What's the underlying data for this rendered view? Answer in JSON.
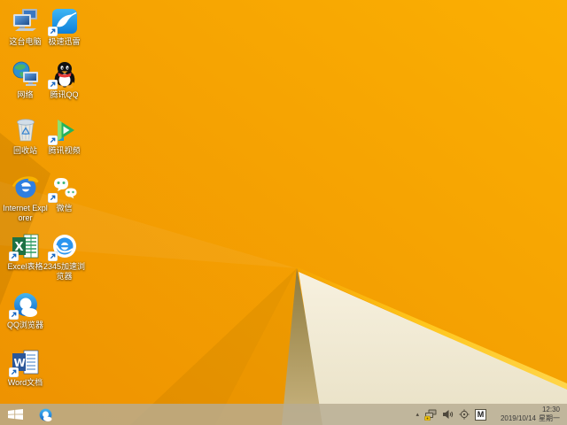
{
  "desktop": {
    "icons": [
      {
        "id": "this-pc",
        "label": "这台电脑",
        "shortcut": false
      },
      {
        "id": "xunlei",
        "label": "极速迅雷",
        "shortcut": true
      },
      {
        "id": "network",
        "label": "网络",
        "shortcut": false
      },
      {
        "id": "tencent-qq",
        "label": "腾讯QQ",
        "shortcut": true
      },
      {
        "id": "recycle-bin",
        "label": "回收站",
        "shortcut": false
      },
      {
        "id": "tencent-video",
        "label": "腾讯视频",
        "shortcut": true
      },
      {
        "id": "internet-explorer",
        "label": "Internet Explorer",
        "shortcut": false
      },
      {
        "id": "wechat",
        "label": "微信",
        "shortcut": true
      },
      {
        "id": "excel",
        "label": "Excel表格",
        "shortcut": true
      },
      {
        "id": "browser-2345",
        "label": "2345加速浏览器",
        "shortcut": true
      },
      {
        "id": "qq-browser",
        "label": "QQ浏览器",
        "shortcut": true
      },
      {
        "id": "word",
        "label": "Word文档",
        "shortcut": true
      }
    ]
  },
  "taskbar": {
    "start_button": {
      "icon": "windows-flag-icon"
    },
    "pinned": [
      {
        "id": "qq-browser",
        "name": "QQ浏览器"
      }
    ],
    "tray": {
      "hidden_icons_glyph": "▴",
      "icons": [
        "network-warning-icon",
        "volume-icon",
        "safety-target-icon",
        "input-method-indicator"
      ],
      "input_indicator": "M",
      "clock": {
        "time": "12:30",
        "date": "2019/10/14",
        "weekday": "星期一"
      }
    }
  },
  "colors": {
    "wallpaper-main-light": "#FBAF02",
    "wallpaper-main-deep": "#EE9201",
    "wallpaper-ridge": "#FFC61C",
    "wallpaper-cream": "#F7F1DF",
    "wallpaper-cream-deep": "#E9E1C6",
    "wallpaper-olive-dark": "#8F7B3E",
    "wallpaper-olive-light": "#C9B47F",
    "taskbar-tint": "#B7AC93",
    "label-text": "#FFFFFF",
    "clock-text": "#3A3A3A"
  }
}
